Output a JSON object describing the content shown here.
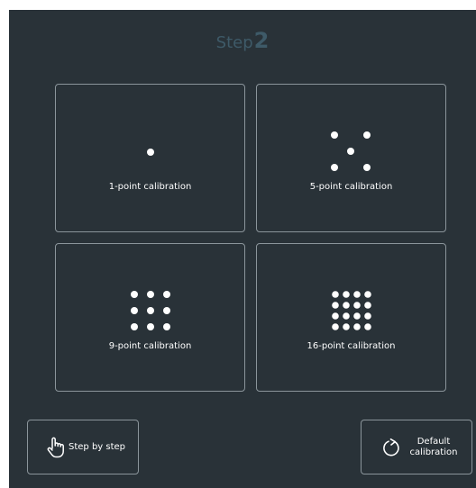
{
  "header": {
    "title_word": "Step",
    "title_number": "2"
  },
  "options": [
    {
      "label": "1-point calibration",
      "points": 1
    },
    {
      "label": "5-point calibration",
      "points": 5
    },
    {
      "label": "9-point calibration",
      "points": 9
    },
    {
      "label": "16-point calibration",
      "points": 16
    }
  ],
  "footer": {
    "step_by_step_label": "Step by step",
    "default_label_line1": "Default",
    "default_label_line2": "calibration"
  },
  "colors": {
    "background": "#293238",
    "border": "#8b959b",
    "title": "#3e5a68",
    "text": "#ffffff"
  },
  "icons": {
    "step_by_step": "hand-pointer-icon",
    "default": "reset-arrow-icon"
  }
}
